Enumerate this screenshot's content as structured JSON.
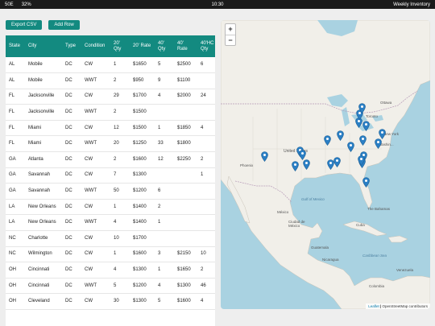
{
  "status_bar": {
    "carrier": "50E",
    "battery": "32%",
    "time": "10:30",
    "app_title": "Weekly Inventory"
  },
  "toolbar": {
    "export_label": "Export CSV",
    "add_row_label": "Add Row"
  },
  "table": {
    "headers": [
      "State",
      "City",
      "Type",
      "Condition",
      "20' Qty",
      "20' Rate",
      "40' Qty",
      "40' Rate",
      "40'HC Qty"
    ],
    "rows": [
      [
        "AL",
        "Mobile",
        "DC",
        "CW",
        "1",
        "$1650",
        "5",
        "$2500",
        "6"
      ],
      [
        "AL",
        "Mobile",
        "DC",
        "WWT",
        "2",
        "$950",
        "9",
        "$1100",
        ""
      ],
      [
        "FL",
        "Jacksonville",
        "DC",
        "CW",
        "29",
        "$1700",
        "4",
        "$2000",
        "24"
      ],
      [
        "FL",
        "Jacksonville",
        "DC",
        "WWT",
        "2",
        "$1500",
        "",
        "",
        ""
      ],
      [
        "FL",
        "Miami",
        "DC",
        "CW",
        "12",
        "$1500",
        "1",
        "$1850",
        "4"
      ],
      [
        "FL",
        "Miami",
        "DC",
        "WWT",
        "20",
        "$1250",
        "33",
        "$1800",
        ""
      ],
      [
        "GA",
        "Atlanta",
        "DC",
        "CW",
        "2",
        "$1600",
        "12",
        "$2250",
        "2"
      ],
      [
        "GA",
        "Savannah",
        "DC",
        "CW",
        "7",
        "$1300",
        "",
        "",
        "1"
      ],
      [
        "GA",
        "Savannah",
        "DC",
        "WWT",
        "50",
        "$1200",
        "6",
        "",
        ""
      ],
      [
        "LA",
        "New Orleans",
        "DC",
        "CW",
        "1",
        "$1400",
        "2",
        "",
        ""
      ],
      [
        "LA",
        "New Orleans",
        "DC",
        "WWT",
        "4",
        "$1400",
        "1",
        "",
        ""
      ],
      [
        "NC",
        "Charlotte",
        "DC",
        "CW",
        "10",
        "$1700",
        "",
        "",
        ""
      ],
      [
        "NC",
        "Wilmington",
        "DC",
        "CW",
        "1",
        "$1600",
        "3",
        "$2150",
        "10"
      ],
      [
        "OH",
        "Cincinnati",
        "DC",
        "CW",
        "4",
        "$1300",
        "1",
        "$1650",
        "2"
      ],
      [
        "OH",
        "Cincinnati",
        "DC",
        "WWT",
        "5",
        "$1200",
        "4",
        "$1300",
        "46"
      ],
      [
        "OH",
        "Cleveland",
        "DC",
        "CW",
        "30",
        "$1300",
        "5",
        "$1600",
        "4"
      ]
    ]
  },
  "map": {
    "zoom_in": "+",
    "zoom_out": "−",
    "attribution": {
      "leaflet": "Leaflet",
      "separator": " | ",
      "osm": "OpenStreetMap contributors"
    },
    "labels": {
      "ottawa": "Ottawa",
      "toronto": "Toronto",
      "new_york": "New York",
      "washington": "Washin...",
      "united_states": "United States",
      "phoenix": "Phoenix",
      "mexico": "México",
      "gulf": "Gulf of Mexico",
      "bahamas": "The Bahamas",
      "cuba": "Cuba",
      "ciudad_mexico": "Ciudad de México",
      "guatemala": "Guatemala",
      "nicaragua": "Nicaragua",
      "venezuela": "Venezuela",
      "caribbean": "Caribbean Sea",
      "colombia": "Colombia"
    }
  },
  "colors": {
    "accent": "#138a80",
    "pin": "#2b7fc4",
    "water": "#a9d2e1",
    "land": "#f1efe9"
  }
}
